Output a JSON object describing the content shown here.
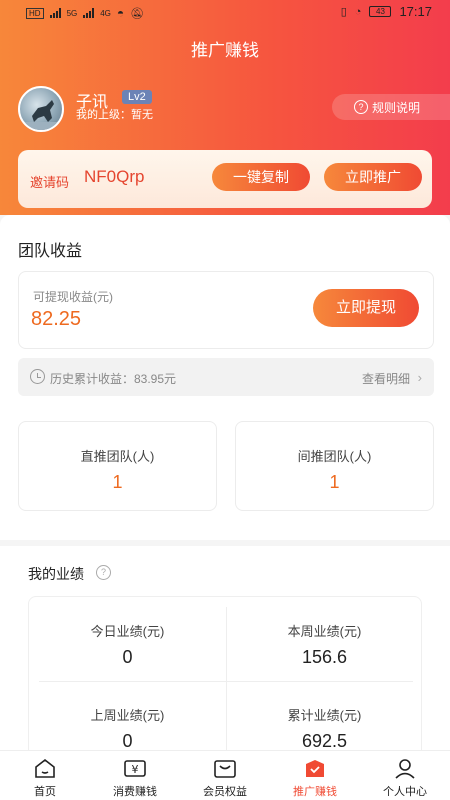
{
  "status_bar": {
    "left_badges": [
      "HD",
      "5G",
      "4G"
    ],
    "time": "17:17",
    "battery": "43"
  },
  "page": {
    "title": "推广赚钱"
  },
  "user": {
    "name": "子讯",
    "level": "Lv2",
    "superior": "我的上级：暂无"
  },
  "rules_button": {
    "label": "规则说明"
  },
  "invite": {
    "label": "邀请码",
    "code": "NF0Qrp",
    "copy_button": "一键复制",
    "promote_button": "立即推广"
  },
  "team_earnings": {
    "title": "团队收益",
    "withdrawable_label": "可提现收益(元)",
    "withdrawable_amount": "82.25",
    "withdraw_button": "立即提现",
    "history_text": "历史累计收益：83.95元",
    "history_link": "查看明细",
    "direct_label": "直推团队(人)",
    "direct_value": "1",
    "indirect_label": "间推团队(人)",
    "indirect_value": "1"
  },
  "performance": {
    "title": "我的业绩",
    "cells": [
      {
        "label": "今日业绩(元)",
        "value": "0"
      },
      {
        "label": "本周业绩(元)",
        "value": "156.6"
      },
      {
        "label": "上周业绩(元)",
        "value": "0"
      },
      {
        "label": "累计业绩(元)",
        "value": "692.5"
      }
    ]
  },
  "tabbar": {
    "items": [
      {
        "label": "首页",
        "icon": "home-icon"
      },
      {
        "label": "消费赚钱",
        "icon": "yen-ticket-icon"
      },
      {
        "label": "会员权益",
        "icon": "gift-box-icon"
      },
      {
        "label": "推广赚钱",
        "icon": "promote-icon",
        "active": true
      },
      {
        "label": "个人中心",
        "icon": "person-icon"
      }
    ]
  },
  "colors": {
    "accent_orange": "#f6883b",
    "accent_red": "#f04a33",
    "amount_orange": "#ee6a20"
  }
}
